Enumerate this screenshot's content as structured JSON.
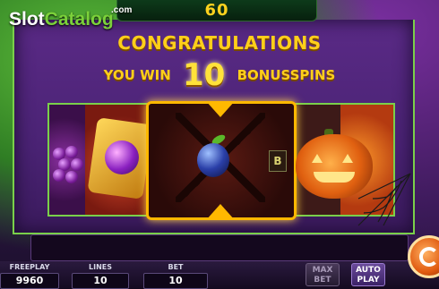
{
  "game": {
    "top_meter_value": "60",
    "logo": {
      "part1": "Slot",
      "part2": "Catalog",
      "suffix": ".com"
    }
  },
  "win_banner": {
    "headline": "CONGRATULATIONS",
    "prefix": "YOU WIN",
    "amount": "10",
    "suffix": "BONUSSPINS"
  },
  "reels": {
    "symbols": [
      "grapes-icon",
      "jewel-icon",
      "plum-icon",
      "bar-icon",
      "pumpkin-icon"
    ],
    "bar_symbol_text": "B"
  },
  "bottom_bar": {
    "freeplay": {
      "label": "FREEPLAY",
      "value": "9960"
    },
    "lines": {
      "label": "LINES",
      "value": "10"
    },
    "bet": {
      "label": "BET",
      "value": "10"
    },
    "max_bet": {
      "line1": "MAX",
      "line2": "BET"
    },
    "auto_play": {
      "line1": "AUTO",
      "line2": "PLAY"
    }
  },
  "colors": {
    "accent_gold": "#ffcf1a",
    "frame_green": "#7ad04a",
    "panel_purple": "#4a2374"
  }
}
